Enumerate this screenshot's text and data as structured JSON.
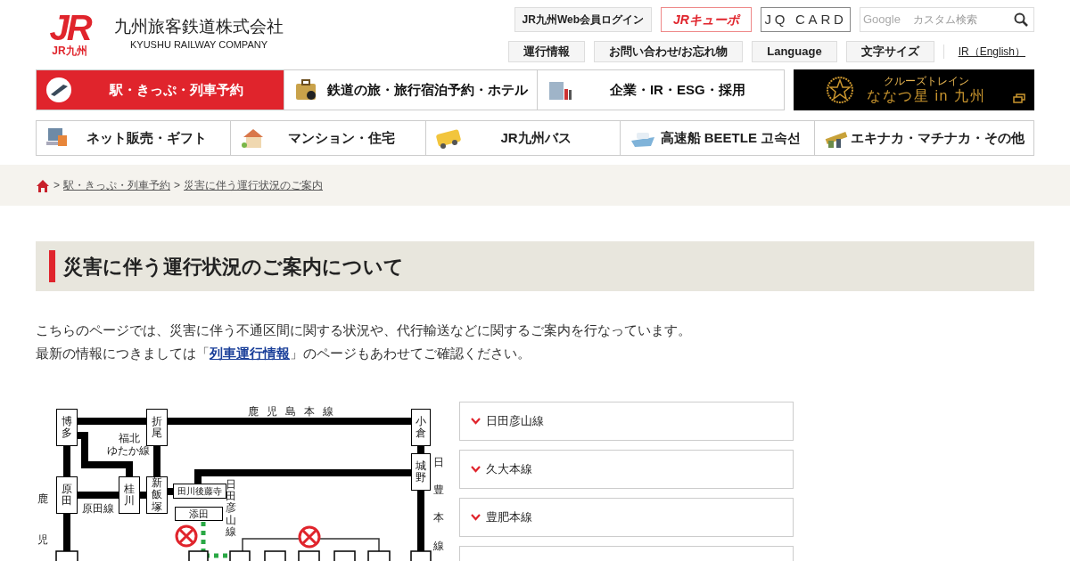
{
  "header": {
    "logo_mark": "JR",
    "logo_sub": "JR九州",
    "company_name": "九州旅客鉄道株式会社",
    "company_name_en": "KYUSHU RAILWAY COMPANY"
  },
  "top_links": [
    {
      "label": "JR九州Web会員ログイン",
      "kind": "plain"
    },
    {
      "label": "JRキューポ",
      "kind": "points"
    },
    {
      "label": "JQ CARD",
      "kind": "card"
    }
  ],
  "search": {
    "brand": "Google",
    "placeholder": "カスタム検索"
  },
  "utility_links": [
    {
      "label": "運行情報",
      "kind": "button"
    },
    {
      "label": "お問い合わせ/お忘れ物",
      "kind": "button"
    },
    {
      "label": "Language",
      "kind": "button"
    },
    {
      "label": "文字サイズ",
      "kind": "button"
    },
    {
      "label": "IR（English）",
      "kind": "link"
    }
  ],
  "main_nav": [
    {
      "label": "駅・きっぷ・列車予約",
      "selected": true
    },
    {
      "label": "鉄道の旅・旅行宿泊予約・ホテル",
      "selected": false
    },
    {
      "label": "企業・IR・ESG・採用",
      "selected": false
    }
  ],
  "banner": {
    "caption": "クルーズトレイン",
    "title": "ななつ星 in 九州"
  },
  "sub_nav": [
    "ネット販売・ギフト",
    "マンション・住宅",
    "JR九州バス",
    "高速船 BEETLE 고속선",
    "エキナカ・マチナカ・その他"
  ],
  "breadcrumb": [
    {
      "separator": ">",
      "label": "駅・きっぷ・列車予約"
    },
    {
      "separator": ">",
      "label": "災害に伴う運行状況のご案内"
    }
  ],
  "heading": "災害に伴う運行状況のご案内について",
  "intro": {
    "line1": "こちらのページでは、災害に伴う不通区間に関する状況や、代行輸送などに関するご案内を行なっています。",
    "line2_before": "最新の情報につきましては「",
    "link": "列車運行情報",
    "line2_after": "」のページもあわせてご確認ください。"
  },
  "diagram": {
    "stations": [
      "博多",
      "折尾",
      "小倉",
      "城野",
      "原田",
      "桂川",
      "新飯塚",
      "田川後藤寺",
      "添田"
    ],
    "line_labels": [
      "鹿児島本線",
      "福北",
      "ゆたか線",
      "原田線",
      "日田彦山線",
      "日豊本線",
      "鹿児"
    ]
  },
  "accordion": [
    {
      "label": "日田彦山線",
      "expanded": false
    },
    {
      "label": "久大本線",
      "expanded": false
    },
    {
      "label": "豊肥本線",
      "expanded": false
    }
  ]
}
